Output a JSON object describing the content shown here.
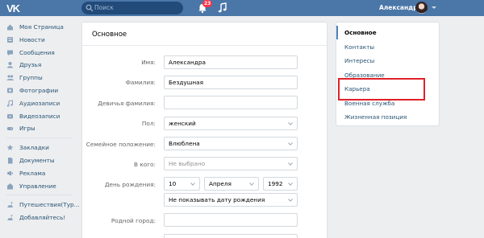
{
  "header": {
    "logo": "VK",
    "search_placeholder": "Поиск",
    "notifications_count": "23",
    "user_name": "Александра"
  },
  "leftnav": {
    "group1": [
      {
        "label": "Моя Страница",
        "icon": "home-icon"
      },
      {
        "label": "Новости",
        "icon": "news-icon"
      },
      {
        "label": "Сообщения",
        "icon": "messages-icon"
      },
      {
        "label": "Друзья",
        "icon": "friends-icon"
      },
      {
        "label": "Группы",
        "icon": "groups-icon"
      },
      {
        "label": "Фотографии",
        "icon": "photos-icon"
      },
      {
        "label": "Аудиозаписи",
        "icon": "audio-icon"
      },
      {
        "label": "Видеозаписи",
        "icon": "video-icon"
      },
      {
        "label": "Игры",
        "icon": "games-icon"
      }
    ],
    "group2": [
      {
        "label": "Закладки",
        "icon": "bookmarks-icon"
      },
      {
        "label": "Документы",
        "icon": "documents-icon"
      },
      {
        "label": "Реклама",
        "icon": "ads-icon"
      },
      {
        "label": "Управление",
        "icon": "manage-icon"
      }
    ],
    "group3": [
      {
        "label": "Путешествия(Тур...",
        "icon": "travel-icon"
      },
      {
        "label": "Добавляйтесь!",
        "icon": "add-icon"
      }
    ]
  },
  "main": {
    "title": "Основное",
    "fields": {
      "name": {
        "label": "Имя:",
        "value": "Александра"
      },
      "surname": {
        "label": "Фамилия:",
        "value": "Бездушная"
      },
      "maiden": {
        "label": "Девичья фамилия:",
        "value": ""
      },
      "gender": {
        "label": "Пол:",
        "value": "женский"
      },
      "marital": {
        "label": "Семейное положение:",
        "value": "Влюблена"
      },
      "in_whom": {
        "label": "В кого:",
        "value": "Не выбрано"
      },
      "birthday": {
        "label": "День рождения:",
        "day": "10",
        "month": "Апреля",
        "year": "1992",
        "visibility": "Не показывать дату рождения"
      },
      "hometown": {
        "label": "Родной город:",
        "value": ""
      }
    }
  },
  "rightnav": {
    "items": [
      {
        "label": "Основное",
        "active": true
      },
      {
        "label": "Контакты"
      },
      {
        "label": "Интересы"
      },
      {
        "label": "Образование"
      },
      {
        "label": "Карьера"
      },
      {
        "label": "Военная служба"
      },
      {
        "label": "Жизненная позиция"
      }
    ]
  },
  "colors": {
    "header": "#4a76a8",
    "link": "#285473",
    "highlight": "#e02129"
  }
}
